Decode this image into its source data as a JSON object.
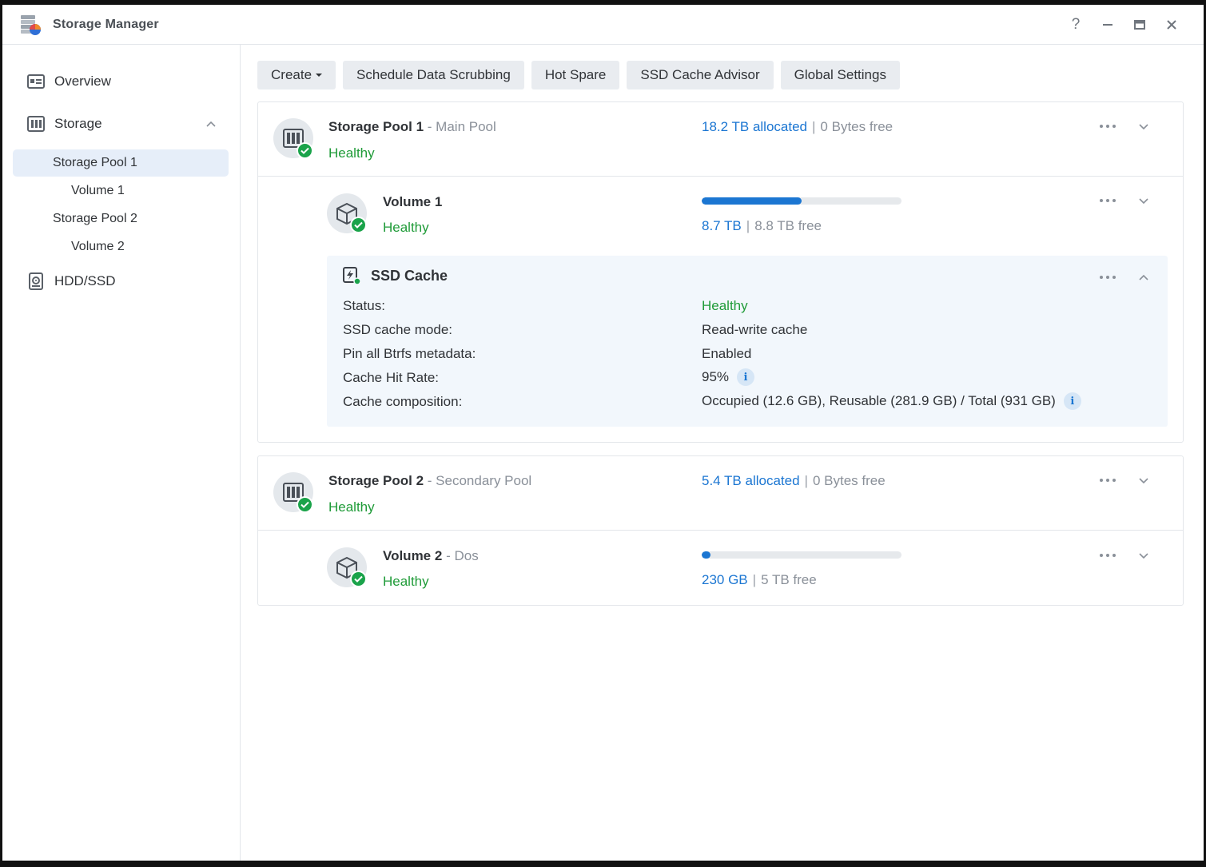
{
  "window": {
    "title": "Storage Manager",
    "controls": [
      "?",
      "—",
      "▭",
      "✕"
    ]
  },
  "sidebar": {
    "overview": "Overview",
    "storage": "Storage",
    "pool1": "Storage Pool 1",
    "volume1": "Volume 1",
    "pool2": "Storage Pool 2",
    "volume2": "Volume 2",
    "hdd": "HDD/SSD"
  },
  "toolbar": {
    "create": "Create",
    "scrub": "Schedule Data Scrubbing",
    "hotspare": "Hot Spare",
    "advisor": "SSD Cache Advisor",
    "global": "Global Settings"
  },
  "pools": [
    {
      "name": "Storage Pool 1",
      "sep": "-",
      "subtitle": "Main Pool",
      "status": "Healthy",
      "allocated": "18.2 TB allocated",
      "divider": "|",
      "free": "0 Bytes free",
      "volume": {
        "name": "Volume 1",
        "sep": "",
        "subtitle": "",
        "status": "Healthy",
        "used": "8.7 TB",
        "divider": "|",
        "free": "8.8 TB free",
        "usage_fraction": 0.5
      }
    },
    {
      "name": "Storage Pool 2",
      "sep": "-",
      "subtitle": "Secondary Pool",
      "status": "Healthy",
      "allocated": "5.4 TB allocated",
      "divider": "|",
      "free": "0 Bytes free",
      "volume": {
        "name": "Volume 2",
        "sep": "-",
        "subtitle": "Dos",
        "status": "Healthy",
        "used": "230 GB",
        "divider": "|",
        "free": "5 TB free",
        "usage_fraction": 0.045
      }
    }
  ],
  "ssd_cache": {
    "title": "SSD Cache",
    "rows": [
      {
        "label": "Status:",
        "value": "Healthy"
      },
      {
        "label": "SSD cache mode:",
        "value": "Read-write cache"
      },
      {
        "label": "Pin all Btrfs metadata:",
        "value": "Enabled"
      },
      {
        "label": "Cache Hit Rate:",
        "value": "95%"
      },
      {
        "label": "Cache composition:",
        "value": "Occupied (12.6 GB), Reusable (281.9 GB) / Total (931 GB)"
      }
    ],
    "info_glyph": "i"
  },
  "colors": {
    "accent": "#1b76d2",
    "healthy": "#1f9b38",
    "selected_bg": "#e6eef9"
  }
}
